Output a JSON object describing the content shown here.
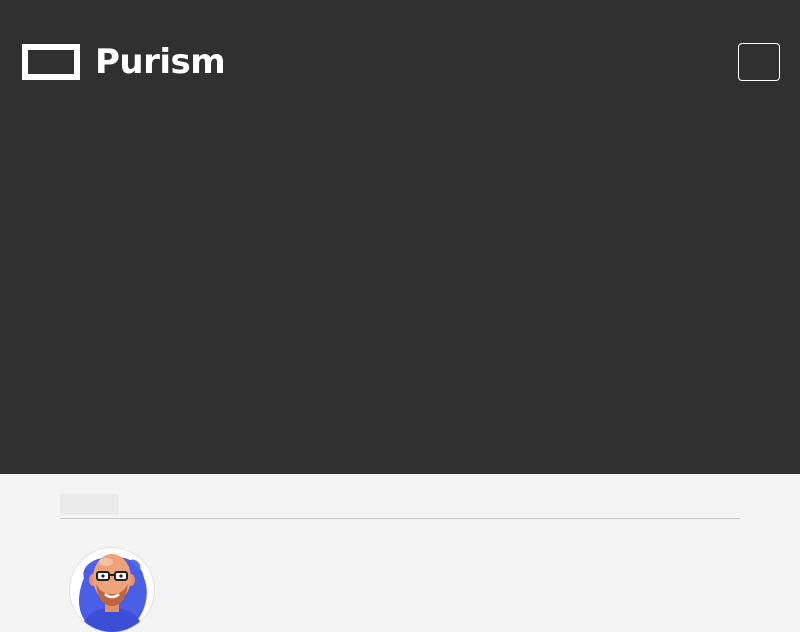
{
  "header": {
    "brand_name": "Purism",
    "logo_icon": "purism-logo-rectangle-icon",
    "menu_icon": "hamburger-menu-icon"
  },
  "article": {
    "category_label": "",
    "author_avatar": "author-avatar-illustration"
  },
  "colors": {
    "hero_background": "#303030",
    "page_background": "#f4f4f4",
    "brand_text": "#ffffff",
    "avatar_splash": "#4a5ee6"
  }
}
